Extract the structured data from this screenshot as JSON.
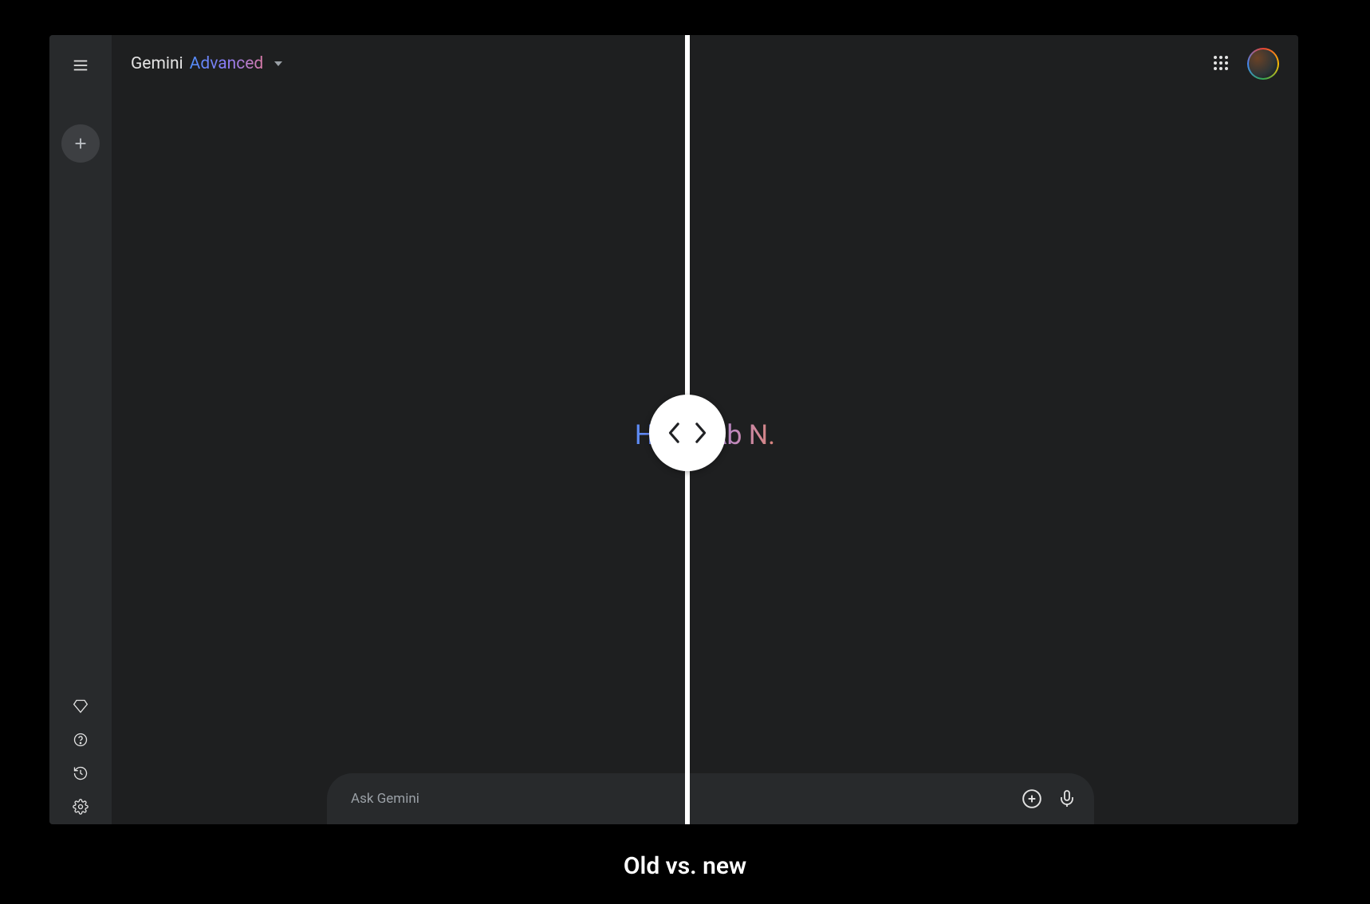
{
  "header": {
    "brand_name": "Gemini",
    "brand_tier": "Advanced"
  },
  "greeting": {
    "text": "Hello, Ab N."
  },
  "input": {
    "placeholder": "Ask Gemini"
  },
  "caption": "Old vs. new"
}
